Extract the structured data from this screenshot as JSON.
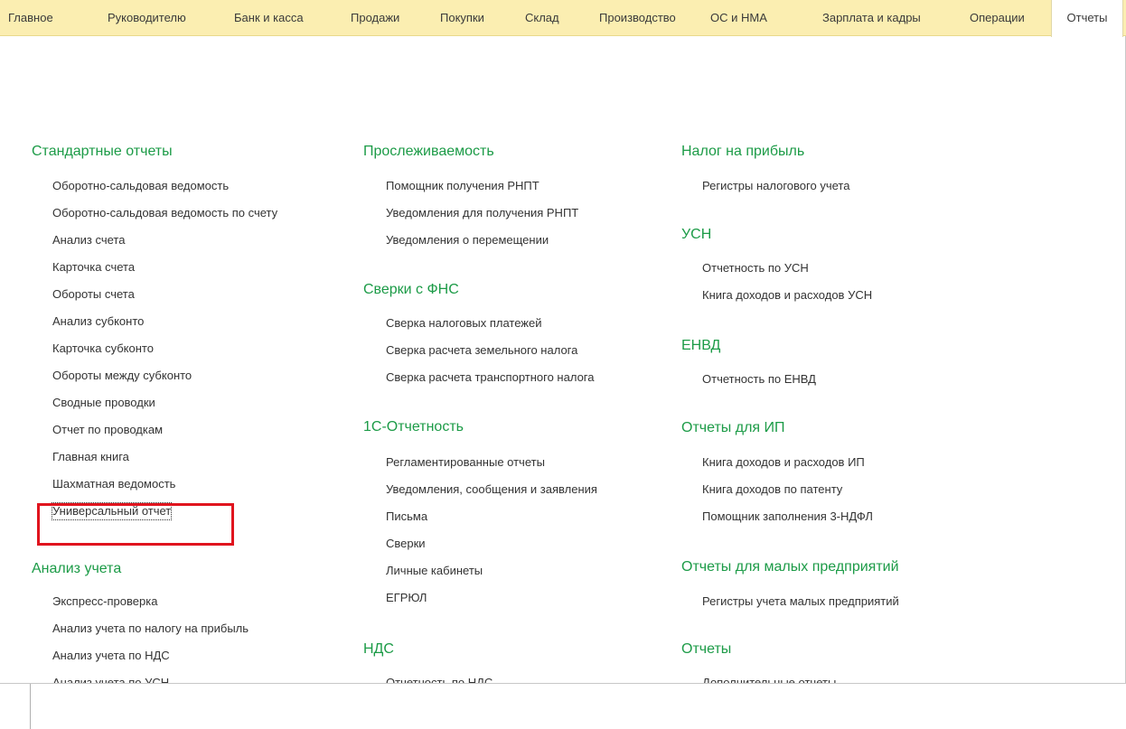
{
  "menu": [
    {
      "label": "Главное"
    },
    {
      "label": "Руководителю"
    },
    {
      "label": "Банк и касса"
    },
    {
      "label": "Продажи"
    },
    {
      "label": "Покупки"
    },
    {
      "label": "Склад"
    },
    {
      "label": "Производство"
    },
    {
      "label": "ОС и НМА"
    },
    {
      "label": "Зарплата и кадры"
    },
    {
      "label": "Операции"
    },
    {
      "label": "Отчеты"
    }
  ],
  "active_tab": "Отчеты",
  "colors": {
    "menubar_bg": "#fbeeb1",
    "group_title": "#1c9b47",
    "link_text": "#333333",
    "highlight": "#e0141e"
  },
  "col1": {
    "standard": {
      "title": "Стандартные отчеты",
      "items": [
        "Оборотно-сальдовая ведомость",
        "Оборотно-сальдовая ведомость по счету",
        "Анализ счета",
        "Карточка счета",
        "Обороты счета",
        "Анализ субконто",
        "Карточка субконто",
        "Обороты между субконто",
        "Сводные проводки",
        "Отчет по проводкам",
        "Главная книга",
        "Шахматная ведомость",
        "Универсальный отчет"
      ]
    },
    "analysis": {
      "title": "Анализ учета",
      "items": [
        "Экспресс-проверка",
        "Анализ учета по налогу на прибыль",
        "Анализ учета по НДС",
        "Анализ учета по УСН"
      ]
    }
  },
  "col2": {
    "traceability": {
      "title": "Прослеживаемость",
      "items": [
        "Помощник получения РНПТ",
        "Уведомления для получения РНПТ",
        "Уведомления о перемещении"
      ]
    },
    "fns": {
      "title": "Сверки с ФНС",
      "items": [
        "Сверка налоговых платежей",
        "Сверка расчета земельного налога",
        "Сверка расчета транспортного налога"
      ]
    },
    "reporting": {
      "title": "1С-Отчетность",
      "items": [
        "Регламентированные отчеты",
        "Уведомления, сообщения и заявления",
        "Письма",
        "Сверки",
        "Личные кабинеты",
        "ЕГРЮЛ"
      ]
    },
    "vat": {
      "title": "НДС",
      "items": [
        "Отчетность по НДС"
      ]
    }
  },
  "col3": {
    "profit": {
      "title": "Налог на прибыль",
      "items": [
        "Регистры налогового учета"
      ]
    },
    "usn": {
      "title": "УСН",
      "items": [
        "Отчетность по УСН",
        "Книга доходов и расходов УСН"
      ]
    },
    "envd": {
      "title": "ЕНВД",
      "items": [
        "Отчетность по ЕНВД"
      ]
    },
    "ip": {
      "title": "Отчеты для ИП",
      "items": [
        "Книга доходов и расходов ИП",
        "Книга доходов по патенту",
        "Помощник заполнения 3-НДФЛ"
      ]
    },
    "small": {
      "title": "Отчеты для малых предприятий",
      "items": [
        "Регистры учета малых предприятий"
      ]
    },
    "reports": {
      "title": "Отчеты",
      "items": [
        "Дополнительные отчеты"
      ]
    }
  }
}
